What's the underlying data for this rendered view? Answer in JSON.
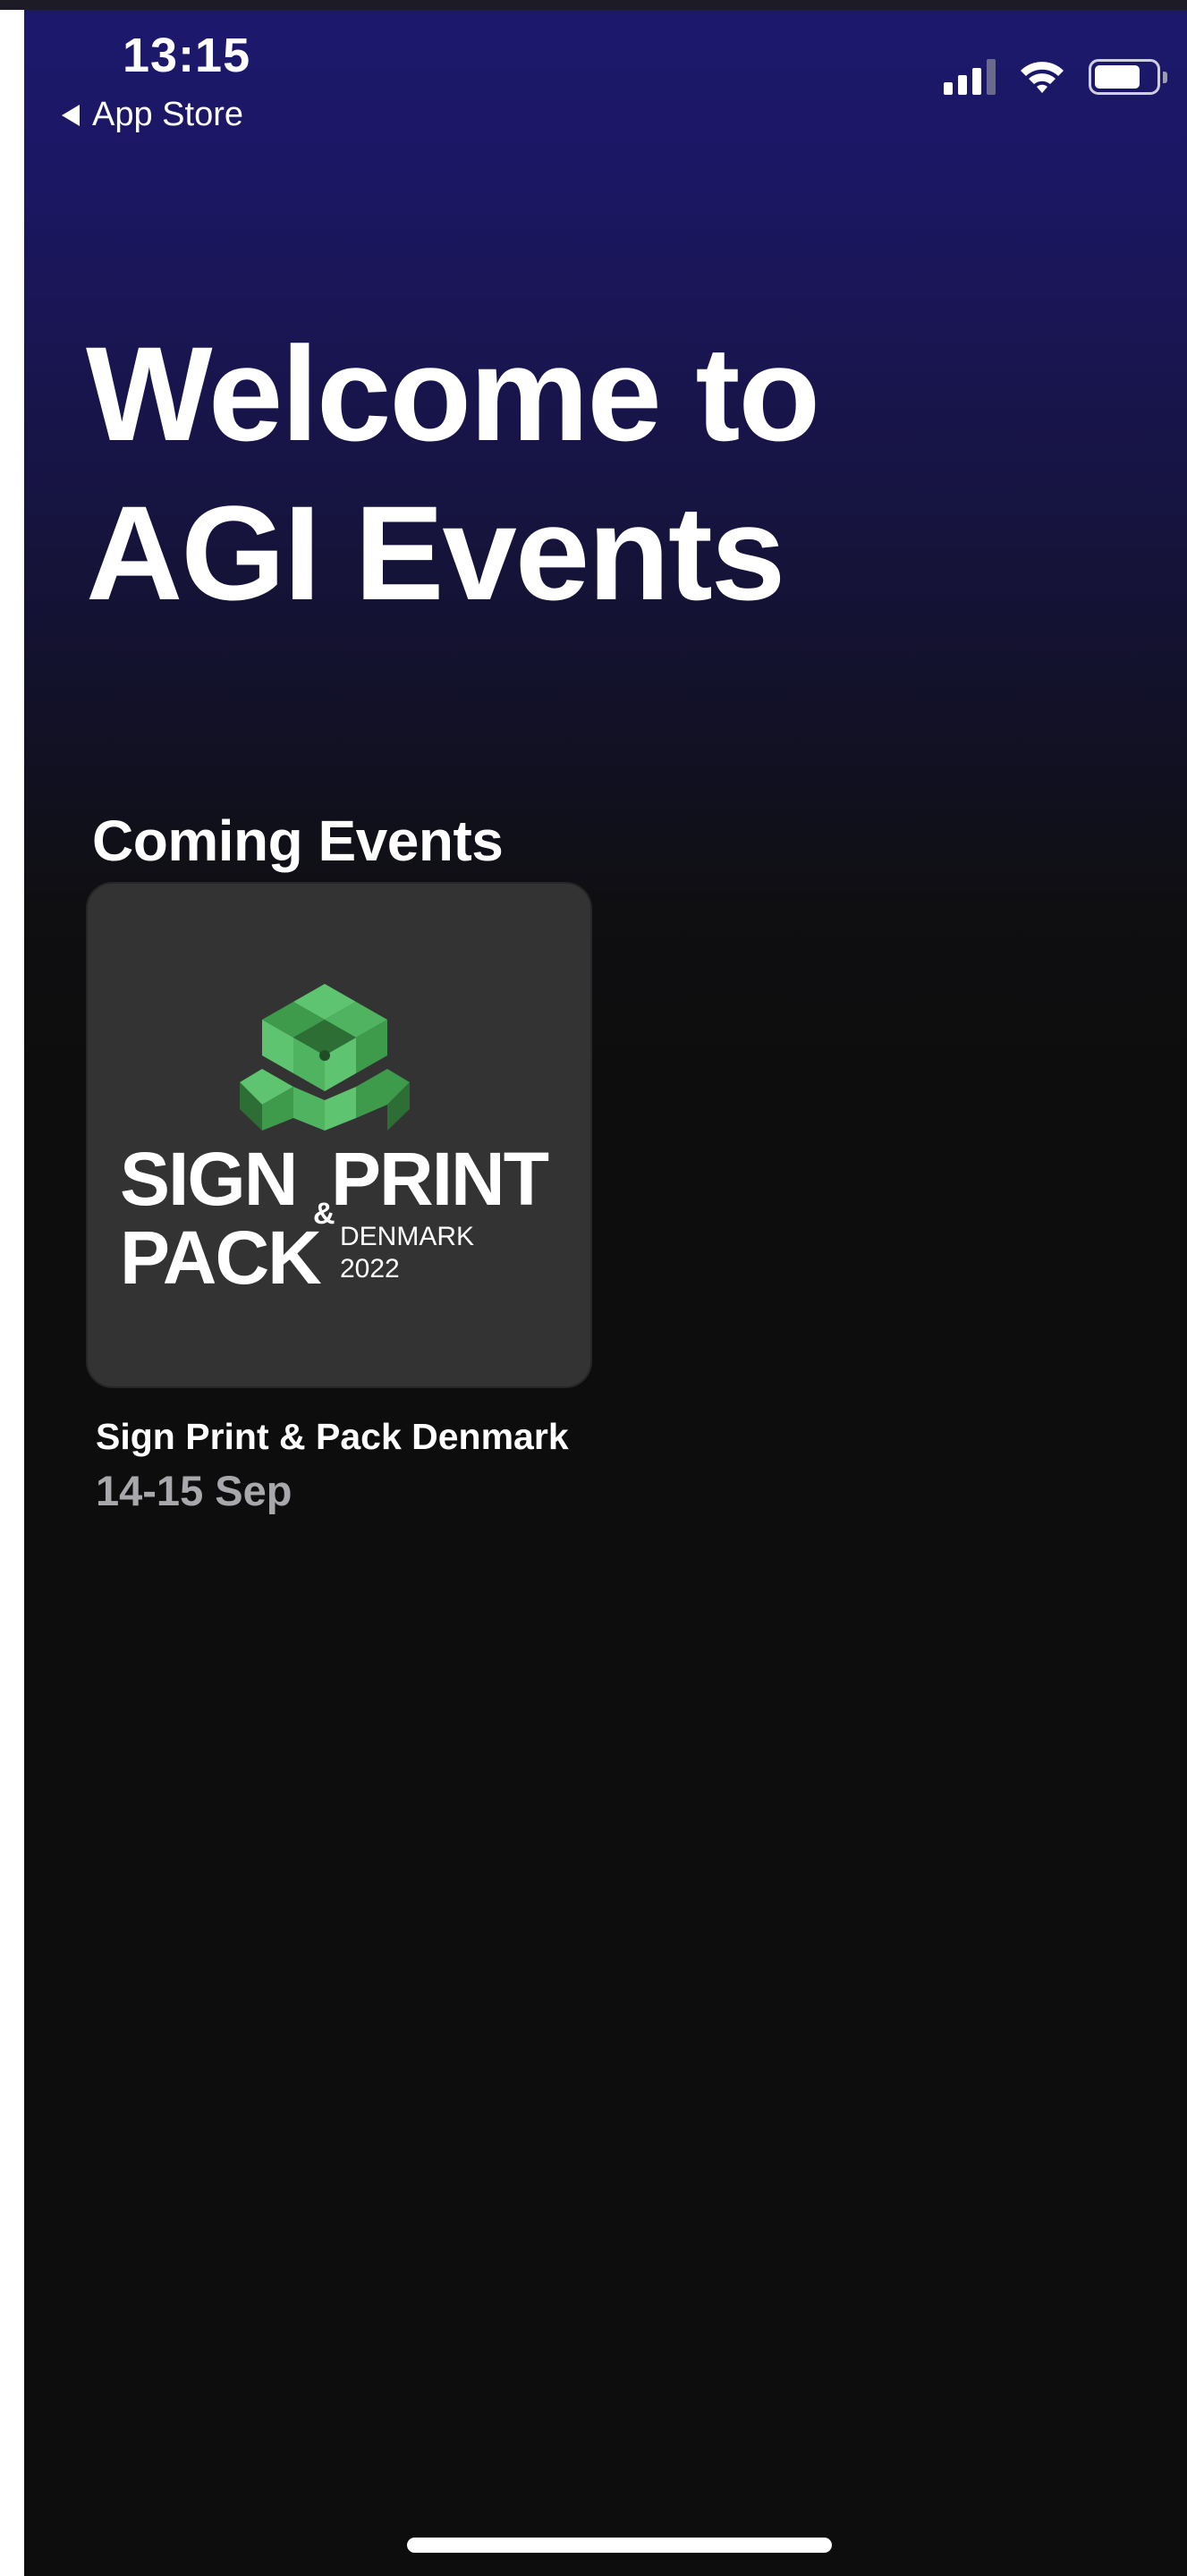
{
  "status_bar": {
    "time": "13:15",
    "back_label": "App Store",
    "wifi_icon": "wifi-icon",
    "signal_icon": "cellular-signal-icon",
    "battery_icon": "battery-icon",
    "battery_level": 0.75
  },
  "header": {
    "welcome_line1": "Welcome to",
    "welcome_line2": "AGI Events"
  },
  "events_section": {
    "title": "Coming Events",
    "events": [
      {
        "name": "Sign Print & Pack Denmark",
        "date": "14-15 Sep",
        "logo": {
          "word1": "SIGN",
          "word2": "PRINT",
          "ampersand": "&",
          "word3": "PACK",
          "country": "DENMARK",
          "year": "2022"
        }
      }
    ]
  },
  "colors": {
    "header_gradient_top": "#1c186d",
    "background": "#0d0d0d",
    "card_background": "#333334",
    "date_text": "#a8a8ac",
    "logo_green_light": "#5fc46f",
    "logo_green_mid": "#3e9b4c",
    "logo_green_dark": "#2c6e34"
  }
}
